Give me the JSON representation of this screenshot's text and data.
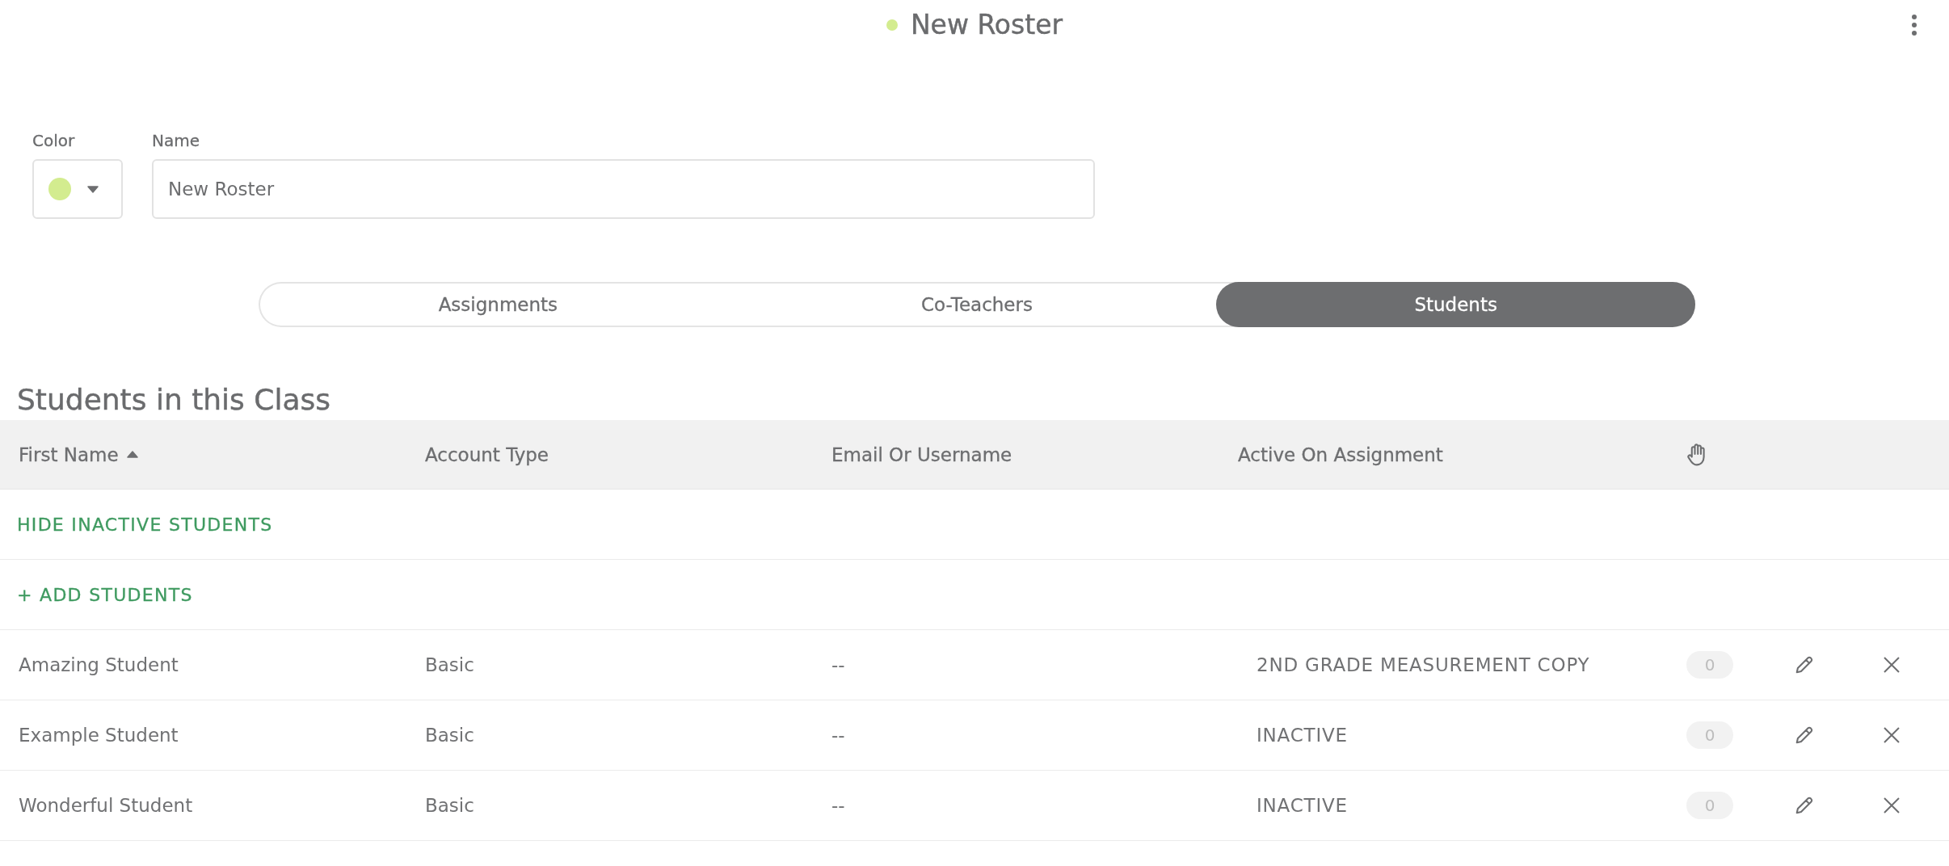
{
  "header": {
    "title": "New Roster",
    "color": "#d3ec8f"
  },
  "form": {
    "color_field": {
      "label": "Color",
      "color": "#d3ec8f"
    },
    "name_field": {
      "label": "Name",
      "value": "New Roster"
    }
  },
  "tabs": [
    {
      "label": "Assignments",
      "selected": false
    },
    {
      "label": "Co-Teachers",
      "selected": false
    },
    {
      "label": "Students",
      "selected": true
    }
  ],
  "section_title": "Students in this Class",
  "table": {
    "columns": [
      {
        "label": "First Name",
        "sorted": true
      },
      {
        "label": "Account Type",
        "sorted": false
      },
      {
        "label": "Email Or Username",
        "sorted": false
      },
      {
        "label": "Active On Assignment",
        "sorted": false
      }
    ],
    "actions": [
      {
        "label": "HIDE INACTIVE STUDENTS"
      },
      {
        "label": "+ ADD STUDENTS"
      }
    ],
    "rows": [
      {
        "first_name": "Amazing Student",
        "account_type": "Basic",
        "email_or_username": "--",
        "active_on_assignment": "2ND GRADE MEASUREMENT COPY",
        "count": "0"
      },
      {
        "first_name": "Example Student",
        "account_type": "Basic",
        "email_or_username": "--",
        "active_on_assignment": "INACTIVE",
        "count": "0"
      },
      {
        "first_name": "Wonderful Student",
        "account_type": "Basic",
        "email_or_username": "--",
        "active_on_assignment": "INACTIVE",
        "count": "0"
      }
    ]
  }
}
